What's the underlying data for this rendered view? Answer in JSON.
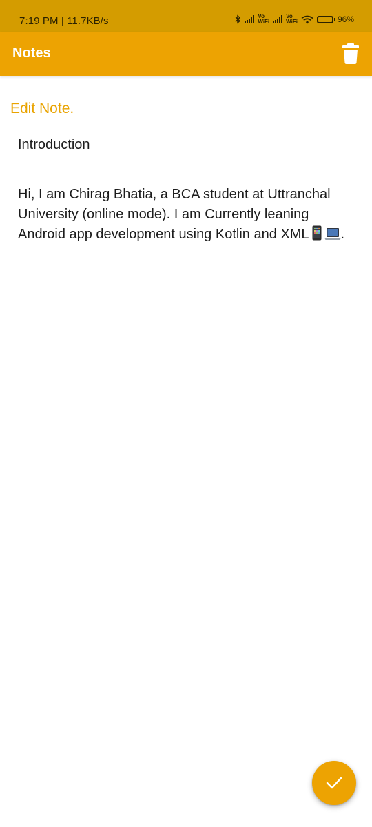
{
  "status_bar": {
    "time": "7:19 PM | 11.7KB/s",
    "vowifi_top": "Vo",
    "vowifi_bottom": "WiFi",
    "battery": "96%"
  },
  "app_bar": {
    "title": "Notes",
    "delete_icon": "trash-icon",
    "accent_color": "#EDA302"
  },
  "editor": {
    "heading": "Edit Note.",
    "title_value": "Introduction",
    "body_text": "Hi, I am Chirag Bhatia, a BCA student at Uttranchal University (online mode). I am Currently leaning Android app development using Kotlin and XML",
    "body_suffix": ".",
    "emoji_icons": [
      "mobile-phone-icon",
      "laptop-icon"
    ]
  },
  "fab": {
    "icon": "check-icon"
  }
}
